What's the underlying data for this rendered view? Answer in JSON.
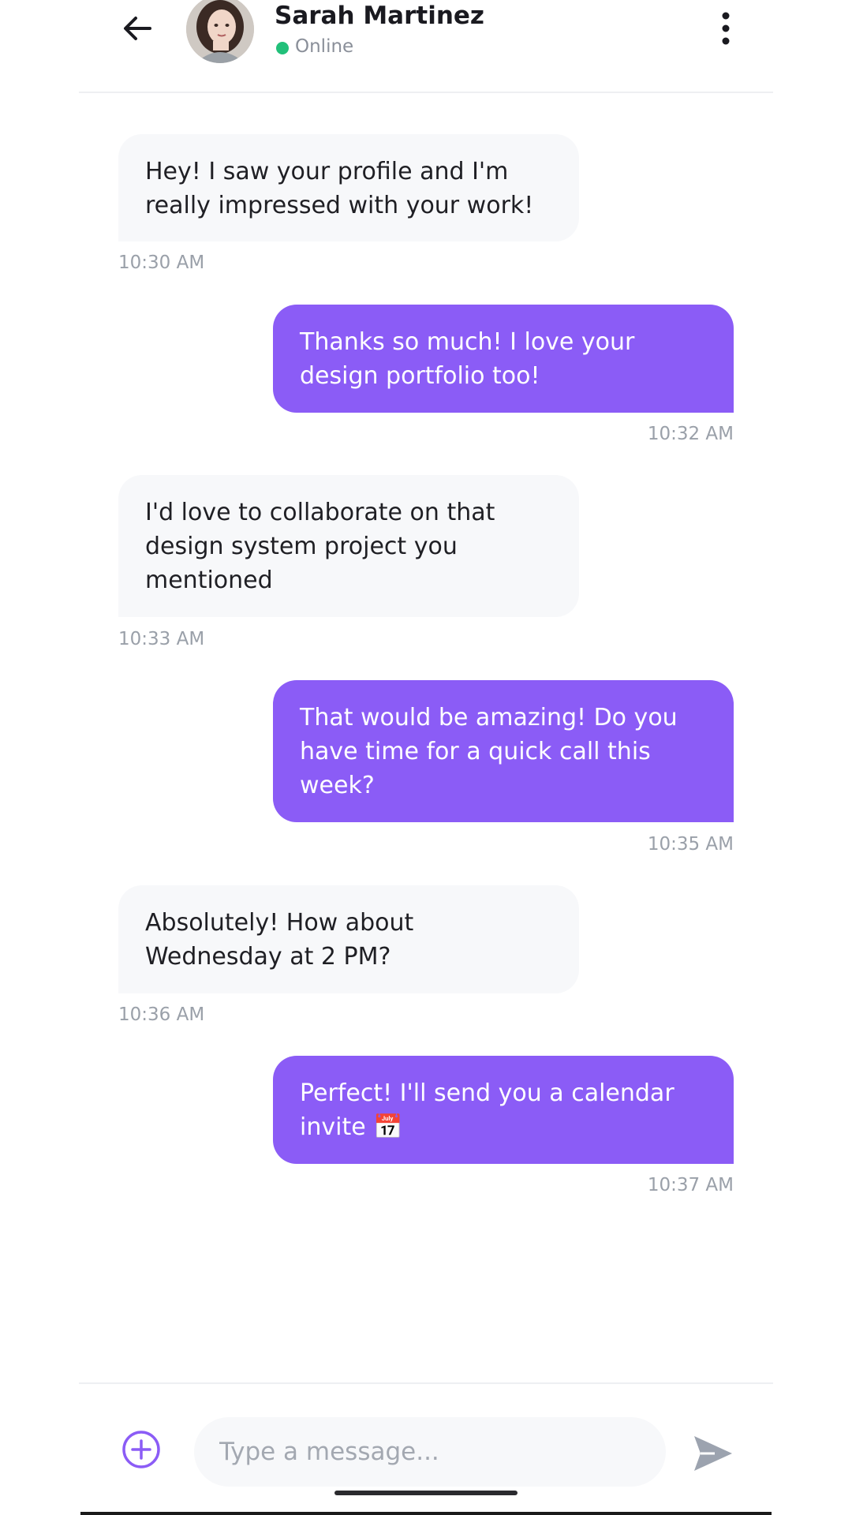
{
  "header": {
    "back_icon": "arrow-left-icon",
    "contact_name": "Sarah Martinez",
    "status": "Online",
    "status_color": "#22c07a",
    "menu_icon": "more-vertical-icon"
  },
  "messages": [
    {
      "direction": "incoming",
      "text": "Hey! I saw your profile and I'm really impressed with your work!",
      "time": "10:30 AM"
    },
    {
      "direction": "outgoing",
      "text": "Thanks so much! I love your design portfolio too!",
      "time": "10:32 AM"
    },
    {
      "direction": "incoming",
      "text": "I'd love to collaborate on that design system project you mentioned",
      "time": "10:33 AM"
    },
    {
      "direction": "outgoing",
      "text": "That would be amazing! Do you have time for a quick call this week?",
      "time": "10:35 AM"
    },
    {
      "direction": "incoming",
      "text": "Absolutely! How about Wednesday at 2 PM?",
      "time": "10:36 AM"
    },
    {
      "direction": "outgoing",
      "text": "Perfect! I'll send you a calendar invite 📅",
      "time": "10:37 AM"
    }
  ],
  "composer": {
    "add_icon": "plus-circle-icon",
    "placeholder": "Type a message...",
    "value": "",
    "send_icon": "send-icon"
  },
  "colors": {
    "accent": "#8b5cf6",
    "incoming_bubble": "#f7f8fa",
    "online": "#22c07a"
  }
}
